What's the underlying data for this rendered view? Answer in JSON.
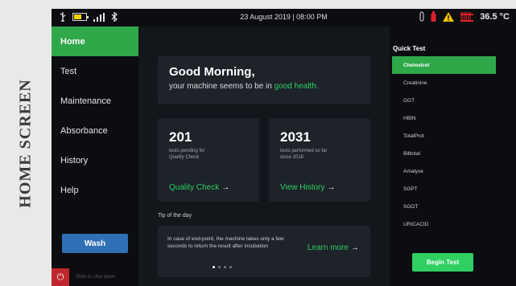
{
  "caption": "HOME SCREEN",
  "statusbar": {
    "datetime": "23 August 2019 | 08:00 PM",
    "temperature": "36.5 °C",
    "icons": [
      "usb-icon",
      "battery-icon",
      "signal-icon",
      "bluetooth-icon",
      "tube-icon",
      "bottle-icon",
      "warning-icon",
      "tubes-rack-icon"
    ]
  },
  "sidebar": {
    "items": [
      {
        "label": "Home"
      },
      {
        "label": "Test"
      },
      {
        "label": "Maintenance"
      },
      {
        "label": "Absorbance"
      },
      {
        "label": "History"
      },
      {
        "label": "Help"
      }
    ],
    "wash_label": "Wash",
    "shutdown_label": "Slide to shut down"
  },
  "greeting": {
    "title": "Good Morning,",
    "line_prefix": "your machine seems to be in ",
    "line_status": "good health."
  },
  "stats": [
    {
      "value": "201",
      "desc_line1": "tests pending for",
      "desc_line2": "Quality Check",
      "link": "Quality Check"
    },
    {
      "value": "2031",
      "desc_line1": "tests performed so far",
      "desc_line2": "since 2018",
      "link": "View History"
    }
  ],
  "tip": {
    "title": "Tip of the day",
    "text": "In case of end-point, the machine takes only a few seconds to return the result after incubation",
    "learn_more": "Learn more"
  },
  "quick_test": {
    "title": "Quick Test",
    "items": [
      "Cholestrol",
      "Creatinine",
      "GGT",
      "HBIN",
      "TotalProt",
      "Billtotal",
      "Amalyse",
      "SGPT",
      "SGOT",
      "URICACID"
    ],
    "begin_label": "Begin Test"
  },
  "colors": {
    "accent_green": "#2fa84a",
    "text_green": "#2fcf62",
    "wash_blue": "#2e6fb5",
    "power_red": "#c0262d",
    "battery_yellow": "#f4d400",
    "warning_yellow": "#f2c200",
    "alert_red": "#e0202a"
  }
}
